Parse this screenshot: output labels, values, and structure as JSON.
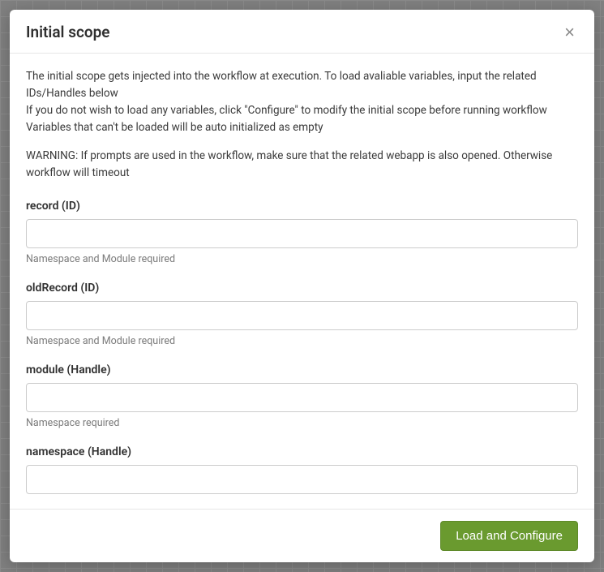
{
  "modal": {
    "title": "Initial scope",
    "intro": {
      "line1": "The initial scope gets injected into the workflow at execution. To load avaliable variables, input the related IDs/Handles below",
      "line2": "If you do not wish to load any variables, click \"Configure\" to modify the initial scope before running workflow",
      "line3": "Variables that can't be loaded will be auto initialized as empty"
    },
    "warning": "WARNING: If prompts are used in the workflow, make sure that the related webapp is also opened. Otherwise workflow will timeout",
    "fields": {
      "record": {
        "label": "record (ID)",
        "value": "",
        "hint": "Namespace and Module required"
      },
      "oldRecord": {
        "label": "oldRecord (ID)",
        "value": "",
        "hint": "Namespace and Module required"
      },
      "module": {
        "label": "module (Handle)",
        "value": "",
        "hint": "Namespace required"
      },
      "namespace": {
        "label": "namespace (Handle)",
        "value": "",
        "hint": ""
      }
    },
    "footer": {
      "submit_label": "Load and Configure"
    }
  }
}
